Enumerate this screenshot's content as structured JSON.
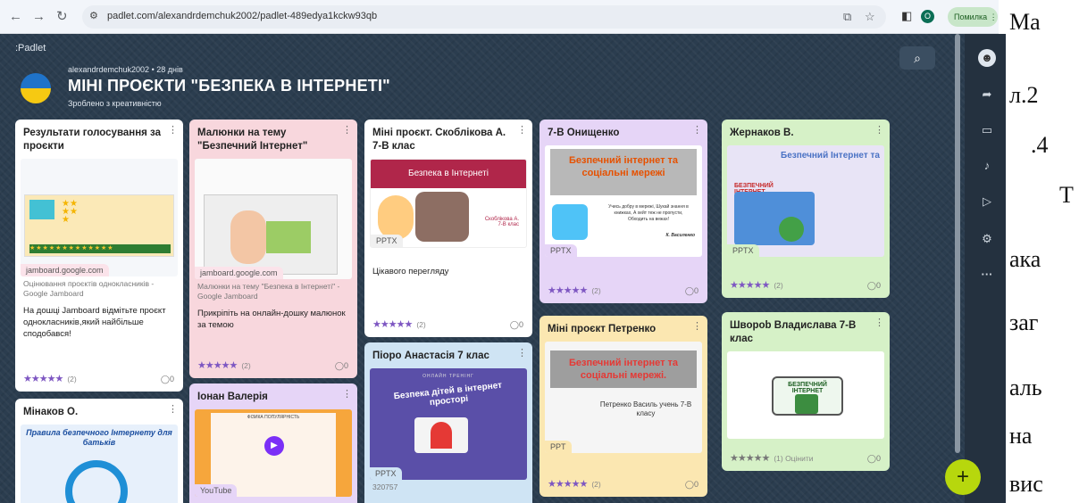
{
  "browser": {
    "url": "padlet.com/alexandrdemchuk2002/padlet-489edya1kckw93qb",
    "profile_initial": "O",
    "error_label": "Помилка"
  },
  "padlet": {
    "logo": ":Padlet",
    "author_meta": "alexandrdemchuk2002 • 28 днів",
    "title": "МІНІ ПРОЄКТИ \"БЕЗПЕКА В ІНТЕРНЕТІ\"",
    "subtitle": "Зроблено з креативністю"
  },
  "cards": {
    "c1": {
      "title": "Результати голосування за проєкти",
      "badge": "jamboard.google.com",
      "grey": "Оцінювання проєктів однокласників - Google Jamboard",
      "text": "На дошці Jamboard відмітьте проєкт однокласників,який найбільше сподобався!",
      "stars": "★★★★★",
      "count": "(2)",
      "comments": "0"
    },
    "c2": {
      "title": "Малюнки на тему \"Безпечний Інтернет\"",
      "badge": "jamboard.google.com",
      "grey": "Малюнки на тему \"Безпека в Інтернеті\" - Google Jamboard",
      "text": "Прикріпіть на онлайн-дошку малюнок за темою",
      "stars": "★★★★★",
      "count": "(2)",
      "comments": "0"
    },
    "c3": {
      "title": "Міні проєкт. Скоблікова А. 7-В клас",
      "slide_title": "Безпека в Інтернеті",
      "slide_author": "Скоблікова А. 7-В клас",
      "badge": "PPTX",
      "text": "Цікавого перегляду",
      "stars": "★★★★★",
      "count": "(2)",
      "comments": "0"
    },
    "c4": {
      "title": "7-В Онищенко",
      "slide_title": "Безпечний інтернет та соціальні мережі",
      "slide_quote": "Учись добру в мережі, Шукай знання в книжках, А хейт теж не пропусти, Обходить на вежах!",
      "slide_author": "К. Василенко",
      "badge": "PPTX",
      "stars": "★★★★★",
      "count": "(2)",
      "comments": "0"
    },
    "c5": {
      "title": "Жернаков В.",
      "slide_title": "Безпечний Інтернет та соціальні мережі",
      "slide_banner": "БЕЗПЕЧНИЙ ІНТЕРНЕТ",
      "badge": "PPTX",
      "stars": "★★★★★",
      "count": "(2)",
      "comments": "0"
    },
    "c6": {
      "title": "Мінаков О.",
      "slide_title": "Правила безпечного Інтернету для батьків"
    },
    "c7": {
      "title": "Іонан Валерія",
      "slide_title": "ФІЗИКА ПОПУЛЯРНІСТЬ",
      "badge": "YouTube"
    },
    "c8": {
      "title": "Піоро Анастасія 7 клас",
      "slide_kicker": "ОНЛАЙН ТРЕНІНГ",
      "slide_title": "Безпека дітей в інтернет просторі",
      "badge": "PPTX",
      "extra": "320757"
    },
    "c9": {
      "title": "Міні проєкт Петренко",
      "slide_title": "Безпечний інтернет та соціальні мережі.",
      "slide_author": "Петренко Василь учень 7-В класу",
      "badge": "PPT",
      "stars": "★★★★★",
      "count": "(2)",
      "comments": "0"
    },
    "c10": {
      "title": "Шворob Владислава 7-В клас",
      "slide_title": "БЕЗПЕЧНИЙ ІНТЕРНЕТ",
      "stars": "★★★★★",
      "count": "(1) Оцінити",
      "comments": "0"
    }
  },
  "doc_text": [
    "Ма",
    "л.2",
    ".4",
    "Т",
    "ака",
    "заг",
    "аль",
    "на",
    "вис"
  ]
}
